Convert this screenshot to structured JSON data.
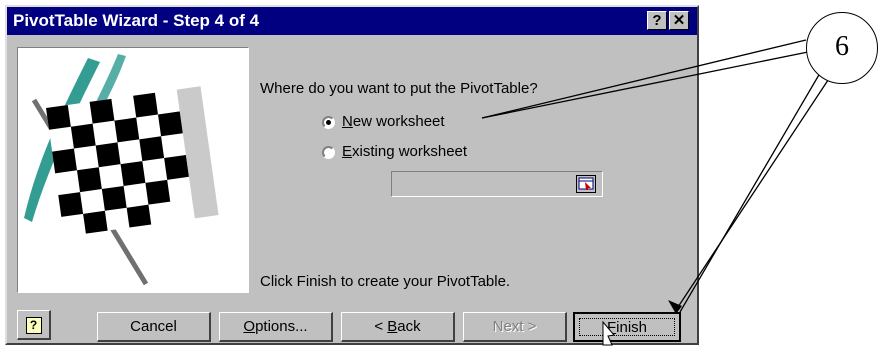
{
  "window": {
    "title": "PivotTable Wizard - Step 4 of 4",
    "help_button": "?",
    "close_button": "✕"
  },
  "prompt": "Where do you want to put the PivotTable?",
  "options": {
    "new_worksheet": {
      "label_first": "N",
      "label_rest": "ew worksheet",
      "selected": true
    },
    "existing_worksheet": {
      "label_first": "E",
      "label_rest": "xisting worksheet",
      "selected": false
    }
  },
  "hint": "Click Finish to create your PivotTable.",
  "buttons": {
    "help_icon": "?",
    "cancel": "Cancel",
    "options_first": "O",
    "options_rest": "ptions...",
    "back_pre": "< ",
    "back_first": "B",
    "back_rest": "ack",
    "next": "Next >",
    "finish_first": "F",
    "finish_rest": "inish"
  },
  "annotation": {
    "number": "6"
  }
}
